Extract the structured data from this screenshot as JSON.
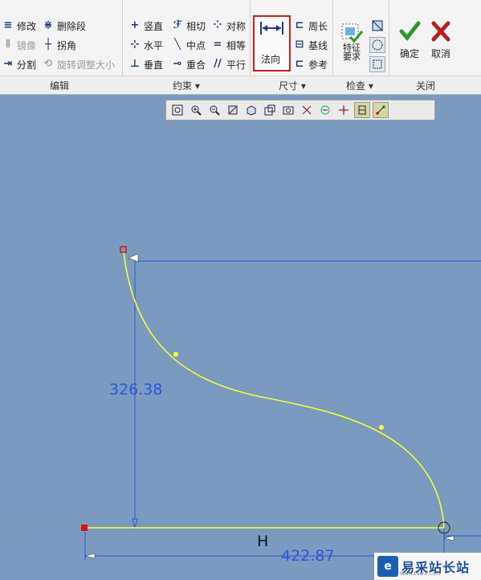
{
  "ribbon": {
    "edit": {
      "label": "编辑",
      "modify": "修改",
      "delete_segment": "删除段",
      "mirror": "镜像",
      "corner": "拐角",
      "divide": "分割",
      "rotate_resize": "旋转调整大小"
    },
    "constrain": {
      "label": "约束",
      "vertical": "竖直",
      "tangent": "相切",
      "symmetric": "对称",
      "horizontal": "水平",
      "midpoint": "中点",
      "equal": "相等",
      "perpendicular": "垂直",
      "coincident": "重合",
      "parallel": "平行"
    },
    "dimension": {
      "label": "尺寸",
      "normal": "法向",
      "perimeter": "周长",
      "baseline": "基线",
      "reference": "参考"
    },
    "inspect": {
      "label": "检查",
      "feature_requirements": "特征要求"
    },
    "close": {
      "label": "关闭",
      "ok": "确定",
      "cancel": "取消"
    }
  },
  "colors": {
    "canvas": "#7a9bbf",
    "curve": "#ffff33",
    "dimension": "#2d56d8",
    "highlight": "#c82020"
  },
  "sketch": {
    "dim_vertical": "326.38",
    "dim_horizontal": "422.87",
    "constraint_h": "H"
  },
  "watermark": {
    "text": "易采站长站",
    "sub": "Www.Easck.Com"
  }
}
